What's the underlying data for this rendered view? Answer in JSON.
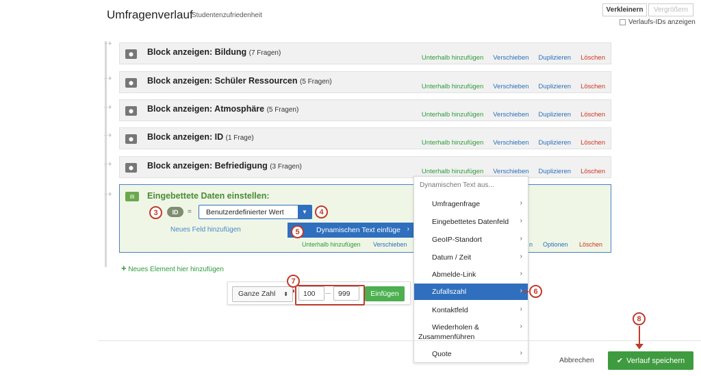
{
  "header": {
    "title": "Umfragenverlauf",
    "subtitle": "Studentenzufriedenheit",
    "zoom_out": "Verkleinern",
    "zoom_in": "Vergrößern",
    "show_ids": "Verlaufs-IDs anzeigen"
  },
  "blocks": [
    {
      "title": "Block anzeigen: Bildung",
      "count": "(7 Fragen)"
    },
    {
      "title": "Block anzeigen: Schüler Ressourcen",
      "count": "(5 Fragen)"
    },
    {
      "title": "Block anzeigen: Atmosphäre",
      "count": "(5 Fragen)"
    },
    {
      "title": "Block anzeigen: ID",
      "count": "(1 Frage)"
    },
    {
      "title": "Block anzeigen: Befriedigung",
      "count": "(3 Fragen)"
    }
  ],
  "actions": {
    "add_below": "Unterhalb hinzufügen",
    "move": "Verschieben",
    "duplicate": "Duplizieren",
    "delete": "Löschen",
    "options": "Optionen",
    "partial_move": "n"
  },
  "embedded": {
    "title": "Eingebettete Daten einstellen:",
    "field_pill": "ID",
    "equals": "=",
    "value_select": "Benutzerdefinierter Wert",
    "new_field": "Neues Feld hinzufügen",
    "dynamic_text": "Dynamischen Text einfüge"
  },
  "menu": {
    "header": "Dynamischen Text aus...",
    "items": [
      "Umfragenfrage",
      "Eingebettetes Datenfeld",
      "GeoIP-Standort",
      "Datum / Zeit",
      "Abmelde-Link",
      "Zufallszahl",
      "Kontaktfeld",
      "Wiederholen &",
      "Zusammenführen",
      "Quote"
    ]
  },
  "add_element": "Neues Element hier hinzufügen",
  "toolbar": {
    "type": "Ganze Zahl",
    "min": "100",
    "dots": "...",
    "max": "999",
    "insert": "Einfügen"
  },
  "footer": {
    "cancel": "Abbrechen",
    "save": "Verlauf speichern"
  },
  "markers": [
    "3",
    "4",
    "5",
    "6",
    "7",
    "8"
  ],
  "colors": {
    "accent": "#2f6fbe",
    "save_green": "#3f9b3f",
    "marker_red": "#c0392b"
  }
}
